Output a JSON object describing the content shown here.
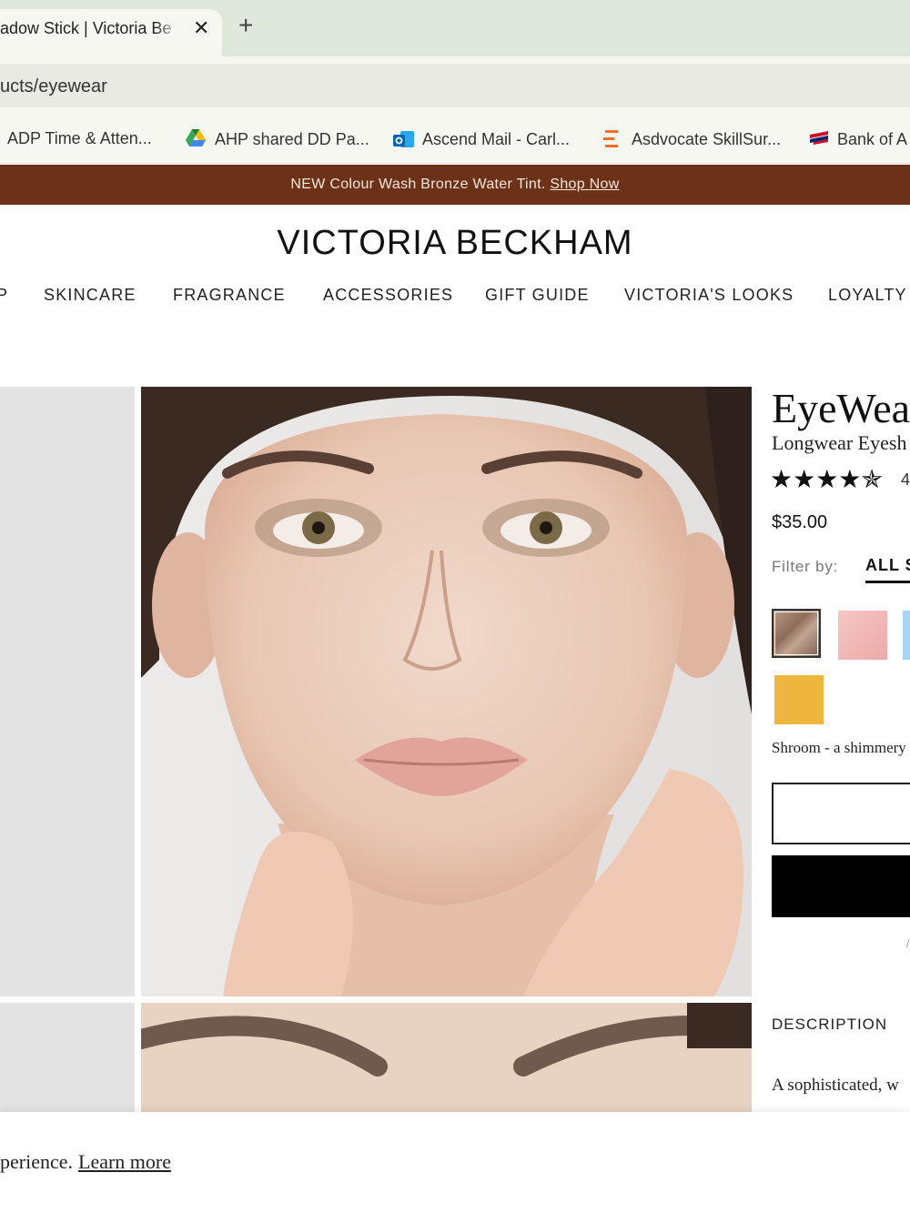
{
  "browser": {
    "tab_title": "adow Stick | Victoria Be",
    "close_glyph": "✕",
    "new_tab_glyph": "+",
    "url": "ucts/eyewear",
    "bookmarks": [
      {
        "label": "ADP Time & Atten...",
        "icon": "adp-icon"
      },
      {
        "label": "AHP shared DD Pa...",
        "icon": "google-drive-icon"
      },
      {
        "label": "Ascend Mail - Carl...",
        "icon": "outlook-icon"
      },
      {
        "label": "Asdvocate SkillSur...",
        "icon": "menu-lines-icon"
      },
      {
        "label": "Bank of A",
        "icon": "bank-flag-icon"
      }
    ]
  },
  "promo": {
    "text": "NEW Colour Wash Bronze Water Tint.",
    "link": "Shop Now"
  },
  "brand": "VICTORIA BECKHAM",
  "nav": {
    "items": [
      "P",
      "SKINCARE",
      "FRAGRANCE",
      "ACCESSORIES",
      "GIFT GUIDE",
      "VICTORIA'S LOOKS",
      "LOYALTY"
    ]
  },
  "product": {
    "title": "EyeWear",
    "subtitle": "Longwear Eyesh",
    "stars_display": "★★★★✯",
    "rating_count": "4",
    "price": "$35.00",
    "filter_label": "Filter by:",
    "filter_selected": "ALL S",
    "swatches": [
      {
        "name": "Shroom",
        "color": "#9a7b69",
        "selected": true
      },
      {
        "name": "pink",
        "color": "#f0b8b8",
        "selected": false
      },
      {
        "name": "blue",
        "color": "#a6d6f5",
        "selected": false
      },
      {
        "name": "yellow",
        "color": "#efb63e",
        "selected": false
      }
    ],
    "shade_description": "Shroom - a shimmery",
    "tiny_mark": "/",
    "description_label": "DESCRIPTION",
    "description_text": "A sophisticated, w"
  },
  "cookie": {
    "text": "perience.",
    "link": "Learn more"
  },
  "colors": {
    "promo_bg": "#6b3217",
    "tabbar_bg": "#dfe8da"
  }
}
